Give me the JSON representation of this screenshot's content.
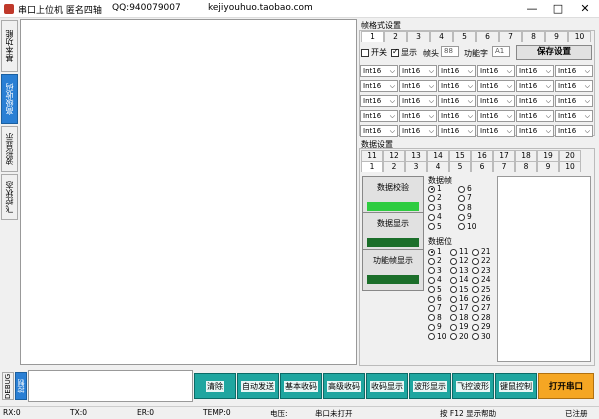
{
  "window": {
    "title": "串口上位机 匿名四轴",
    "qq": "QQ:940079007",
    "url": "kejiyouhuo.taobao.com",
    "min": "—",
    "max": "□",
    "close": "✕"
  },
  "vtabs": [
    "基本功能",
    "高级收码",
    "波形显示",
    "飞控状态"
  ],
  "frame_settings": {
    "title": "帧格式设置",
    "tabs": [
      "1",
      "2",
      "3",
      "4",
      "5",
      "6",
      "7",
      "8",
      "9",
      "10"
    ],
    "switch_label": "开关",
    "show_label": "显示",
    "head_label": "帧头",
    "head_value": "88",
    "func_label": "功能字",
    "func_value": "A1",
    "save_button": "保存设置"
  },
  "dropdowns": {
    "value": "Int16",
    "arrow": "⌵"
  },
  "data_settings": {
    "title": "数据设置",
    "tabs_row1": [
      "11",
      "12",
      "13",
      "14",
      "15",
      "16",
      "17",
      "18",
      "19",
      "20"
    ],
    "tabs_row2": [
      "1",
      "2",
      "3",
      "4",
      "5",
      "6",
      "7",
      "8",
      "9",
      "10"
    ]
  },
  "side_buttons": [
    {
      "label": "数据校验"
    },
    {
      "label": "数据显示"
    },
    {
      "label": "功能帧显示"
    }
  ],
  "data_frame": {
    "title": "数据帧",
    "options": [
      "1",
      "2",
      "3",
      "4",
      "5",
      "6",
      "7",
      "8",
      "9",
      "10"
    ],
    "selected": "1"
  },
  "data_bits": {
    "title": "数据位",
    "options": [
      "1",
      "2",
      "3",
      "4",
      "5",
      "6",
      "7",
      "8",
      "9",
      "10",
      "11",
      "12",
      "13",
      "14",
      "15",
      "16",
      "17",
      "18",
      "19",
      "20",
      "21",
      "22",
      "23",
      "24",
      "25",
      "26",
      "27",
      "28",
      "29",
      "30"
    ],
    "selected": "1"
  },
  "bottom_tabs": [
    "DEBUG",
    "控制"
  ],
  "bottom_buttons": [
    "清除",
    "自动发送",
    "基本收码",
    "高级收码",
    "收码显示",
    "波形显示",
    "飞控波形",
    "键鼠控制"
  ],
  "open_port_button": "打开串口",
  "status": {
    "rx": "RX:0",
    "tx": "TX:0",
    "er": "ER:0",
    "temp": "TEMP:0",
    "voltage": "电压:",
    "port": "串口未打开",
    "help": "按 F12 显示帮助",
    "brand": "已注册"
  },
  "colors": {
    "accent_blue": "#2a7fd4",
    "teal": "#1fa6a0",
    "orange": "#f5a623"
  }
}
